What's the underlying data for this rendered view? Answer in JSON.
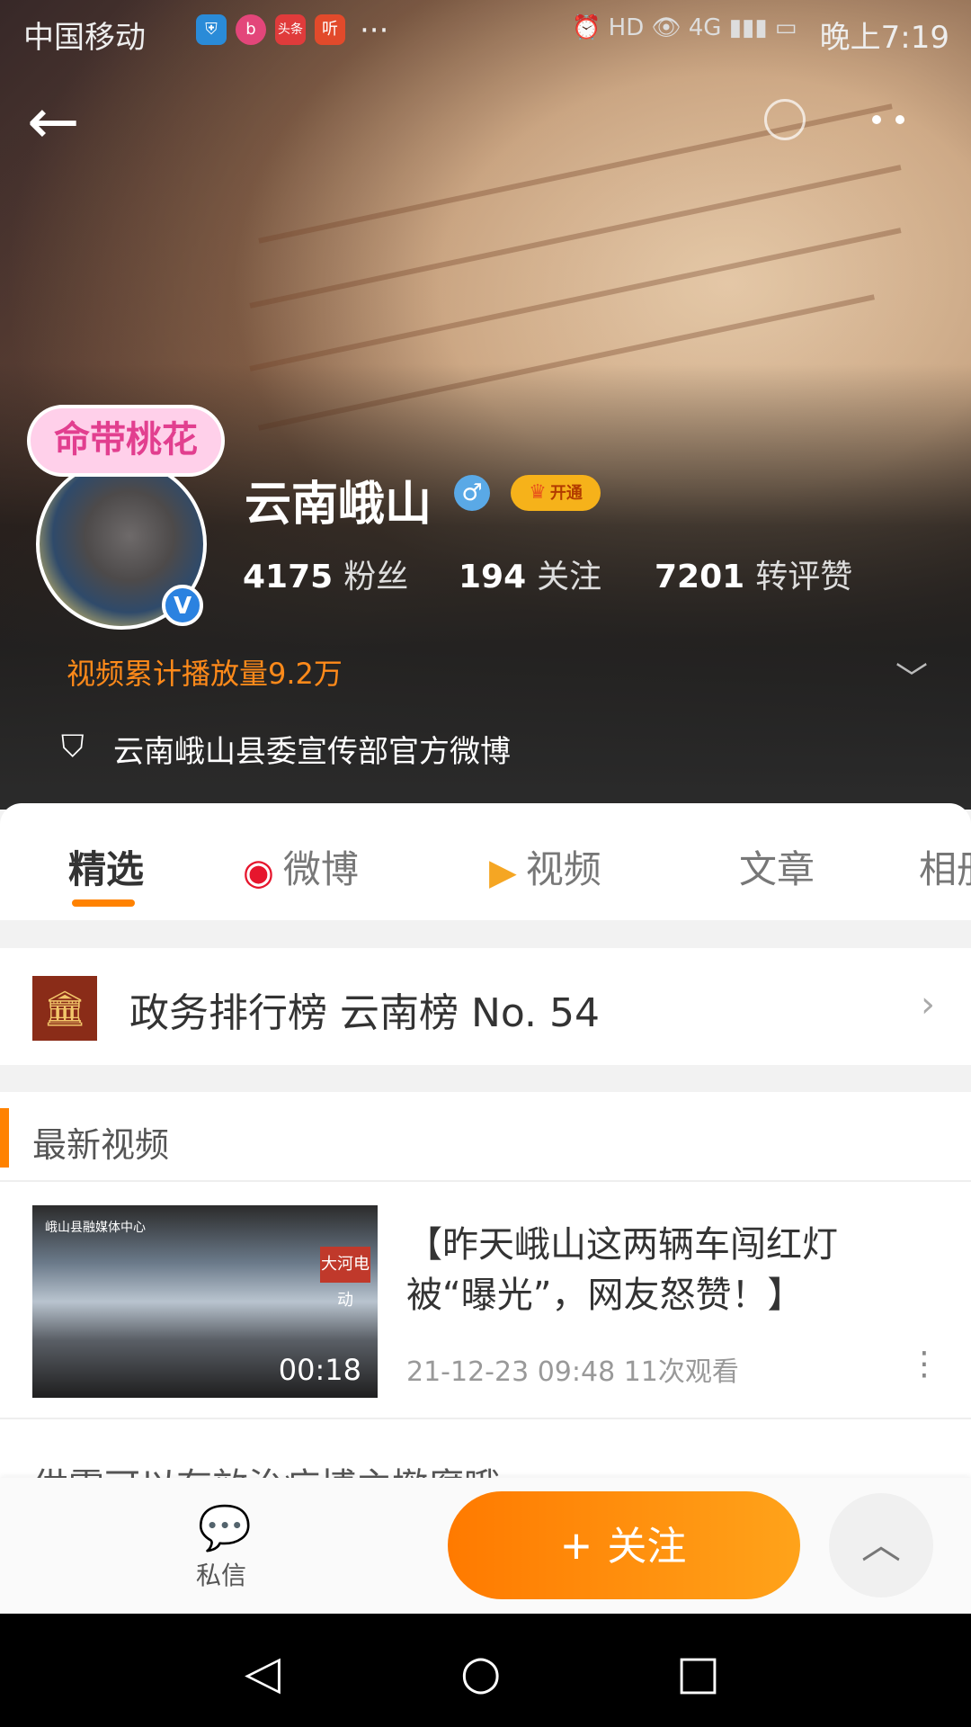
{
  "status_bar": {
    "carrier": "中国移动",
    "badges": [
      "shield",
      "bilibili",
      "头条",
      "听"
    ],
    "dots": "···",
    "time": "晚上7:19"
  },
  "profile": {
    "name": "云南峨山",
    "gender_symbol": "♂",
    "vip_label": "开通",
    "avatar_frame_text": "命带桃花",
    "verified_mark": "V",
    "stats": [
      {
        "value": "4175",
        "label": "粉丝"
      },
      {
        "value": "194",
        "label": "关注"
      },
      {
        "value": "7201",
        "label": "转评赞"
      }
    ],
    "play_count_text": "视频累计播放量9.2万",
    "description": "云南峨山县委宣传部官方微博"
  },
  "tabs": [
    {
      "label": "精选",
      "active": true
    },
    {
      "label": "微博"
    },
    {
      "label": "视频"
    },
    {
      "label": "文章"
    },
    {
      "label": "相册"
    }
  ],
  "ranking": {
    "text": "政务排行榜 云南榜 No. 54"
  },
  "latest_videos": {
    "title": "最新视频",
    "items": [
      {
        "title": "【昨天峨山这两辆车闯红灯被“曝光”，网友怒赞！】",
        "meta": "21-12-23 09:48  11次观看",
        "duration": "00:18",
        "thumb_brand": "峨山县融媒体中心",
        "thumb_sign": "大河电动"
      }
    ],
    "peek_text": "供需可以有效治疗博主撤腐哦"
  },
  "action_bar": {
    "message_label": "私信",
    "follow_label": "关注"
  },
  "colors": {
    "accent": "#ff8200",
    "verified": "#2b82e0",
    "vip": "#f6b21a"
  }
}
